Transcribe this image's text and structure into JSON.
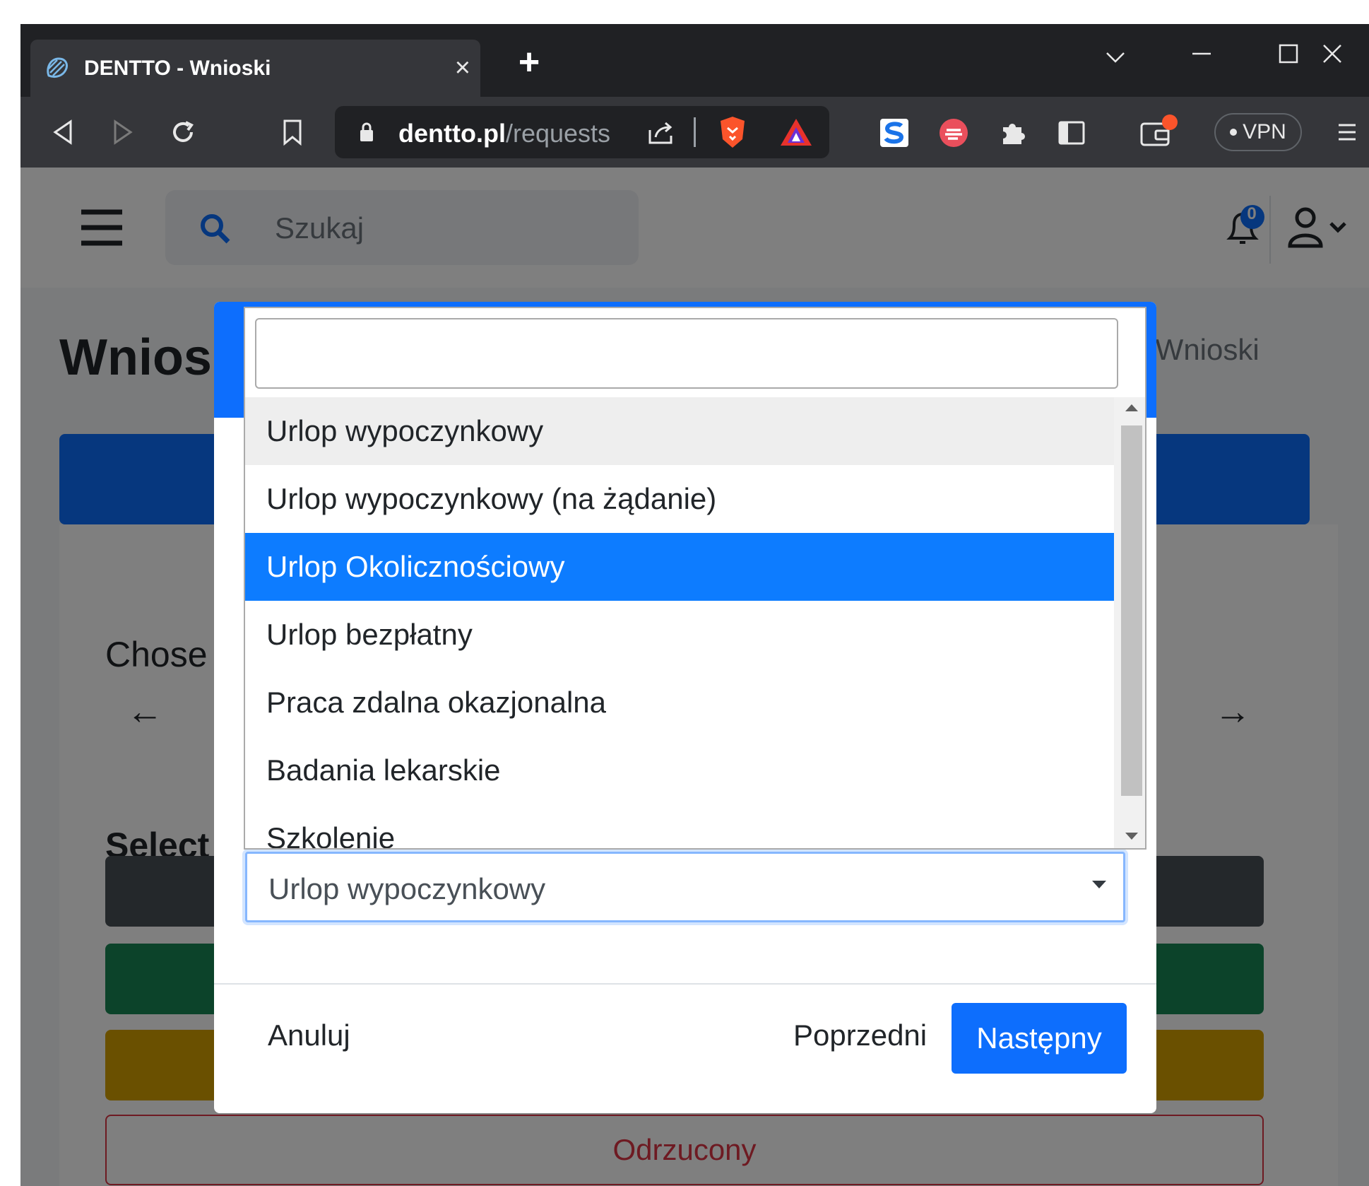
{
  "browser": {
    "tab_title": "DENTTO - Wnioski",
    "tab_close": "×",
    "new_tab": "+",
    "url_domain": "dentto.pl",
    "url_path": "/requests",
    "vpn_label": "VPN",
    "window_controls": [
      "chevron-down",
      "minimize",
      "maximize",
      "close"
    ]
  },
  "topnav": {
    "search_placeholder": "Szukaj",
    "notification_count": "0"
  },
  "page": {
    "title": "Wnios",
    "breadcrumb": "t / Wnioski",
    "chose_label": "Chose",
    "select_label": "Select",
    "prev_arrow": "←",
    "next_arrow": "→",
    "status_colors": [
      "#495057",
      "#198754",
      "#d4a000"
    ],
    "status_odrzucony": "Odrzucony"
  },
  "modal": {
    "select_value": "Urlop wypoczynkowy",
    "cancel_label": "Anuluj",
    "previous_label": "Poprzedni",
    "next_label": "Następny"
  },
  "dropdown": {
    "search_value": "",
    "options": [
      "Urlop wypoczynkowy",
      "Urlop wypoczynkowy (na żądanie)",
      "Urlop Okolicznościowy",
      "Urlop bezpłatny",
      "Praca zdalna okazjonalna",
      "Badania lekarskie",
      "Szkolenie"
    ],
    "hovered_option": "Urlop wypoczynkowy",
    "highlighted_option": "Urlop Okolicznościowy"
  },
  "colors": {
    "primary": "#0d6efd",
    "highlight": "#0d7cff",
    "danger": "#dc3545"
  }
}
